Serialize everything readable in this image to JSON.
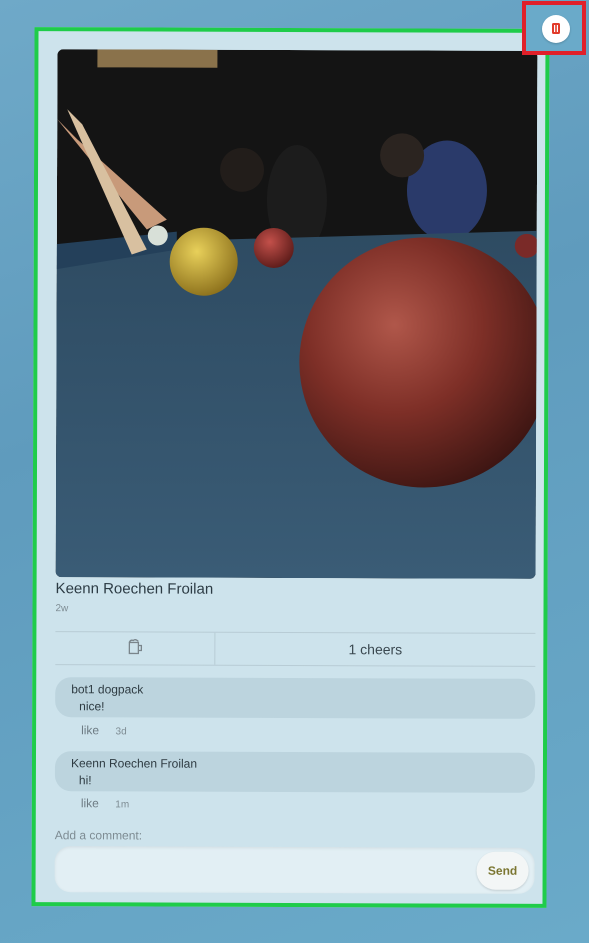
{
  "post": {
    "author": "Keenn Roechen Froilan",
    "time_ago": "2w",
    "photo_icon": "billiards-photo",
    "cheers_label": "1 cheers",
    "cheer_icon": "beer-mug-icon"
  },
  "comments": [
    {
      "author": "bot1 dogpack",
      "text": "nice!",
      "like_label": "like",
      "time": "3d"
    },
    {
      "author": "Keenn Roechen Froilan",
      "text": "hi!",
      "like_label": "like",
      "time": "1m"
    }
  ],
  "composer": {
    "label": "Add a comment:",
    "placeholder": "",
    "send_label": "Send"
  },
  "colors": {
    "highlight_card": "#1fcc4a",
    "highlight_delete": "#e0202a",
    "delete_icon": "#e23b2a"
  }
}
